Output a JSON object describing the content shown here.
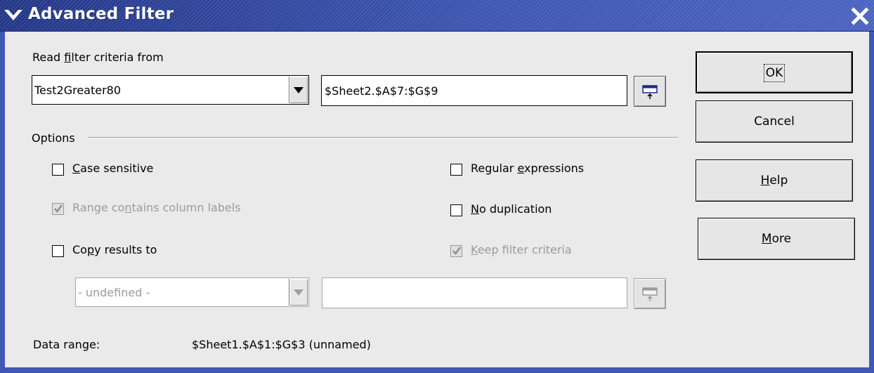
{
  "window": {
    "title": "Advanced Filter",
    "menu_icon": "chevron-down-icon",
    "close_icon": "close-icon"
  },
  "criteria": {
    "label": "Read filter criteria from",
    "combo_value": "Test2Greater80",
    "range_value": "$Sheet2.$A$7:$G$9"
  },
  "options": {
    "section_label": "Options",
    "case_sensitive": {
      "label": "Case sensitive",
      "checked": false,
      "enabled": true
    },
    "range_contains_labels": {
      "label": "Range contains column labels",
      "checked": true,
      "enabled": false
    },
    "copy_results_to": {
      "label": "Copy results to",
      "checked": false,
      "enabled": true
    },
    "regular_expressions": {
      "label": "Regular expressions",
      "checked": false,
      "enabled": true
    },
    "no_duplication": {
      "label": "No duplication",
      "checked": false,
      "enabled": true
    },
    "keep_filter_criteria": {
      "label": "Keep filter criteria",
      "checked": true,
      "enabled": false
    },
    "copy_combo_value": "- undefined -",
    "copy_field_value": ""
  },
  "data_range": {
    "label": "Data range:",
    "value": "$Sheet1.$A$1:$G$3 (unnamed)"
  },
  "buttons": {
    "ok": "OK",
    "cancel": "Cancel",
    "help": "Help",
    "more": "More"
  },
  "colors": {
    "titlebar": "#2a3e93",
    "dialog_bg": "#eaeaea",
    "disabled_text": "#9b9b9b"
  }
}
